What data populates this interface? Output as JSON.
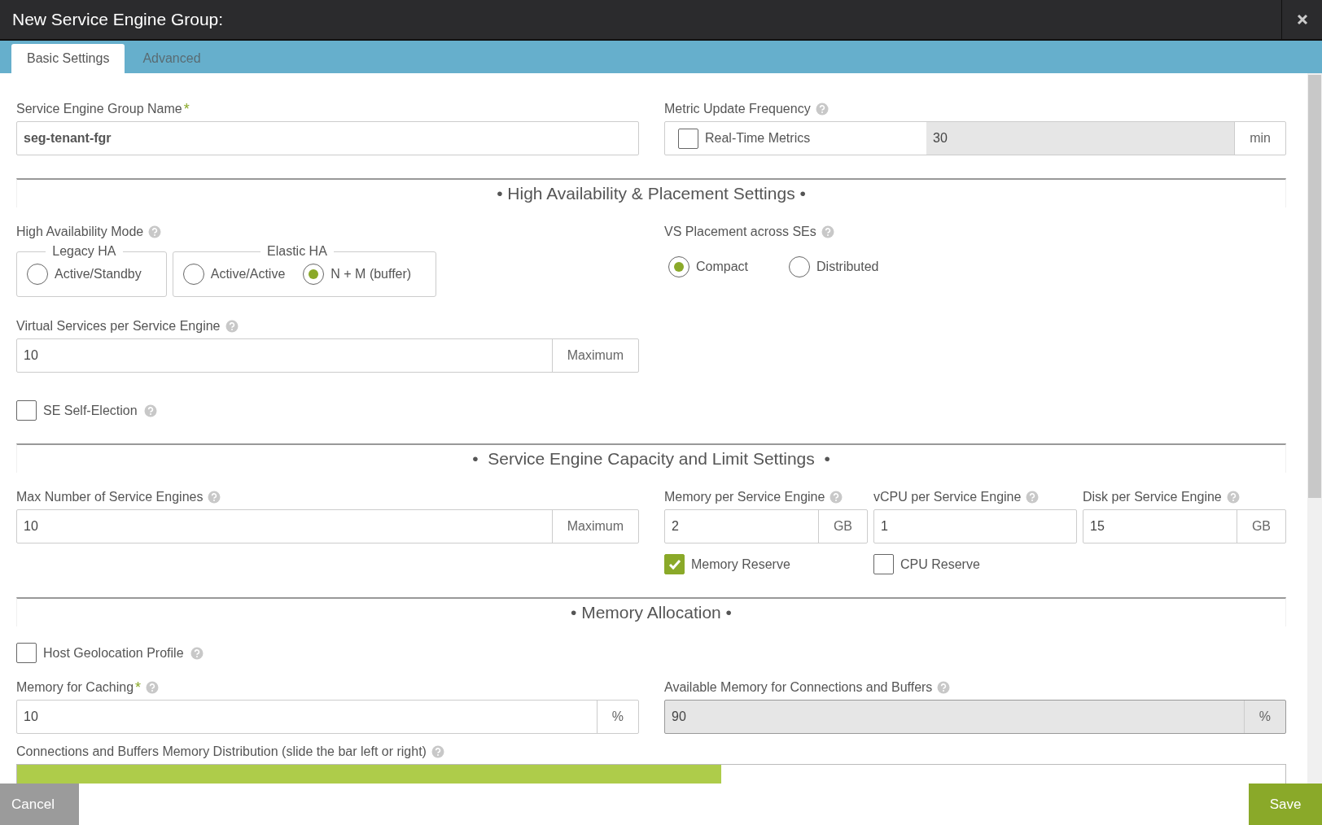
{
  "dialog": {
    "title": "New Service Engine Group:"
  },
  "tabs": [
    {
      "label": "Basic Settings",
      "selected": true
    },
    {
      "label": "Advanced",
      "selected": false
    }
  ],
  "name_field": {
    "label": "Service Engine Group Name",
    "required": "*",
    "value": "seg-tenant-fgr"
  },
  "metric_update": {
    "label": "Metric Update Frequency",
    "checkbox": {
      "label": "Real-Time Metrics",
      "checked": false
    },
    "value": "30",
    "disabled": true,
    "unit": "min"
  },
  "ha_section": {
    "title": "• High Availability & Placement Settings •",
    "ha_mode": {
      "label": "High Availability Mode",
      "groups": [
        {
          "legend": "Legacy HA",
          "options": [
            {
              "label": "Active/Standby",
              "selected": false
            }
          ]
        },
        {
          "legend": "Elastic HA",
          "options": [
            {
              "label": "Active/Active",
              "selected": false
            },
            {
              "label": "N + M (buffer)",
              "selected": true
            }
          ]
        }
      ]
    },
    "vs_per_se": {
      "label": "Virtual Services per Service Engine",
      "value": "10",
      "unit": "Maximum"
    },
    "self_election": {
      "label": "SE Self-Election",
      "checked": false
    },
    "vs_placement": {
      "label": "VS Placement across SEs",
      "options": [
        {
          "label": "Compact",
          "selected": true
        },
        {
          "label": "Distributed",
          "selected": false
        }
      ]
    }
  },
  "capacity_section": {
    "title": "•  Service Engine Capacity and Limit Settings  •",
    "max_se": {
      "label": "Max Number of Service Engines",
      "value": "10",
      "unit": "Maximum"
    },
    "resources": [
      {
        "label": "Memory per Service Engine",
        "value": "2",
        "unit": "GB"
      },
      {
        "label": "vCPU per Service Engine",
        "value": "1"
      },
      {
        "label": "Disk per Service Engine",
        "value": "15",
        "unit": "GB"
      }
    ],
    "reserves": [
      {
        "label": "Memory Reserve",
        "checked": true
      },
      {
        "label": "CPU Reserve",
        "checked": false
      }
    ]
  },
  "memory_section": {
    "title": "• Memory Allocation •",
    "host_geolocation": {
      "label": "Host Geolocation Profile",
      "checked": false
    },
    "caching": {
      "label": "Memory for Caching",
      "required": "*",
      "value": "10",
      "unit": "%"
    },
    "available": {
      "label": "Available Memory for Connections and Buffers",
      "value": "90",
      "unit": "%",
      "disabled": true
    },
    "distribution": {
      "label": "Connections and Buffers Memory Distribution (slide the bar left or right)",
      "level": 0.555
    }
  },
  "footer": {
    "buttons": [
      {
        "label": "Cancel",
        "kind": "secondary"
      },
      {
        "label": "Save",
        "kind": "primary"
      }
    ]
  }
}
